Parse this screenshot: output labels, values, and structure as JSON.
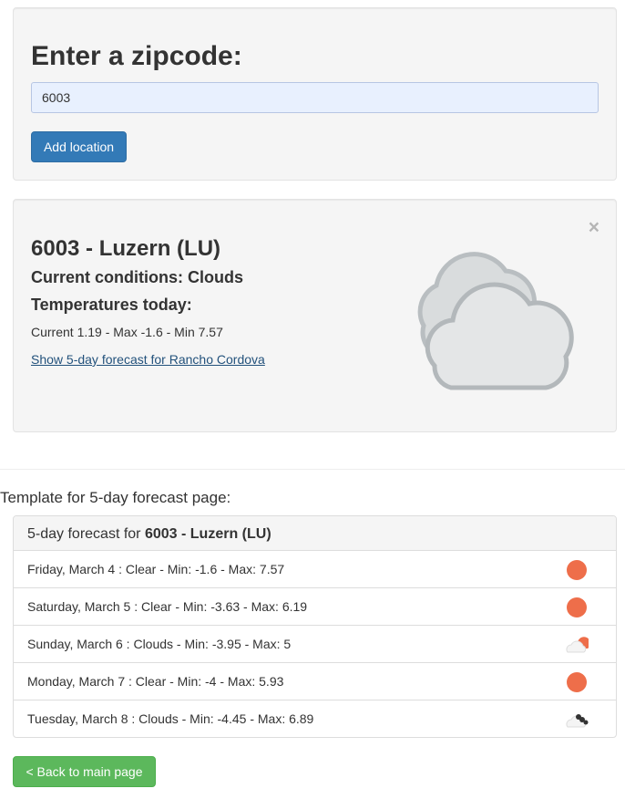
{
  "zip_form": {
    "title": "Enter a zipcode:",
    "input_value": "6003",
    "add_button": "Add location"
  },
  "location_card": {
    "close_symbol": "×",
    "title": "6003 - Luzern (LU)",
    "conditions": "Current conditions: Clouds",
    "temps_heading": "Temperatures today:",
    "current_line": "Current 1.19 - Max -1.6 - Min 7.57",
    "forecast_link": "Show 5-day forecast for Rancho Cordova",
    "weather_icon": "clouds-icon"
  },
  "forecast": {
    "section_heading": "Template for 5-day forecast page:",
    "panel_prefix": "5-day forecast for ",
    "panel_location": "6003 - Luzern (LU)",
    "rows": [
      {
        "text": "Friday, March 4 : Clear - Min: -1.6 - Max: 7.57",
        "icon": "clear-sun-icon"
      },
      {
        "text": "Saturday, March 5 : Clear - Min: -3.63 - Max: 6.19",
        "icon": "clear-sun-icon"
      },
      {
        "text": "Sunday, March 6 : Clouds - Min: -3.95 - Max: 5",
        "icon": "partly-cloudy-icon"
      },
      {
        "text": "Monday, March 7 : Clear - Min: -4 - Max: 5.93",
        "icon": "clear-sun-icon"
      },
      {
        "text": "Tuesday, March 8 : Clouds - Min: -4.45 - Max: 6.89",
        "icon": "dark-clouds-icon"
      }
    ],
    "back_button": "< Back to main page"
  },
  "colors": {
    "primary": "#337ab7",
    "success": "#5cb85c",
    "sun": "#ee6e4a",
    "link": "#23527c"
  }
}
